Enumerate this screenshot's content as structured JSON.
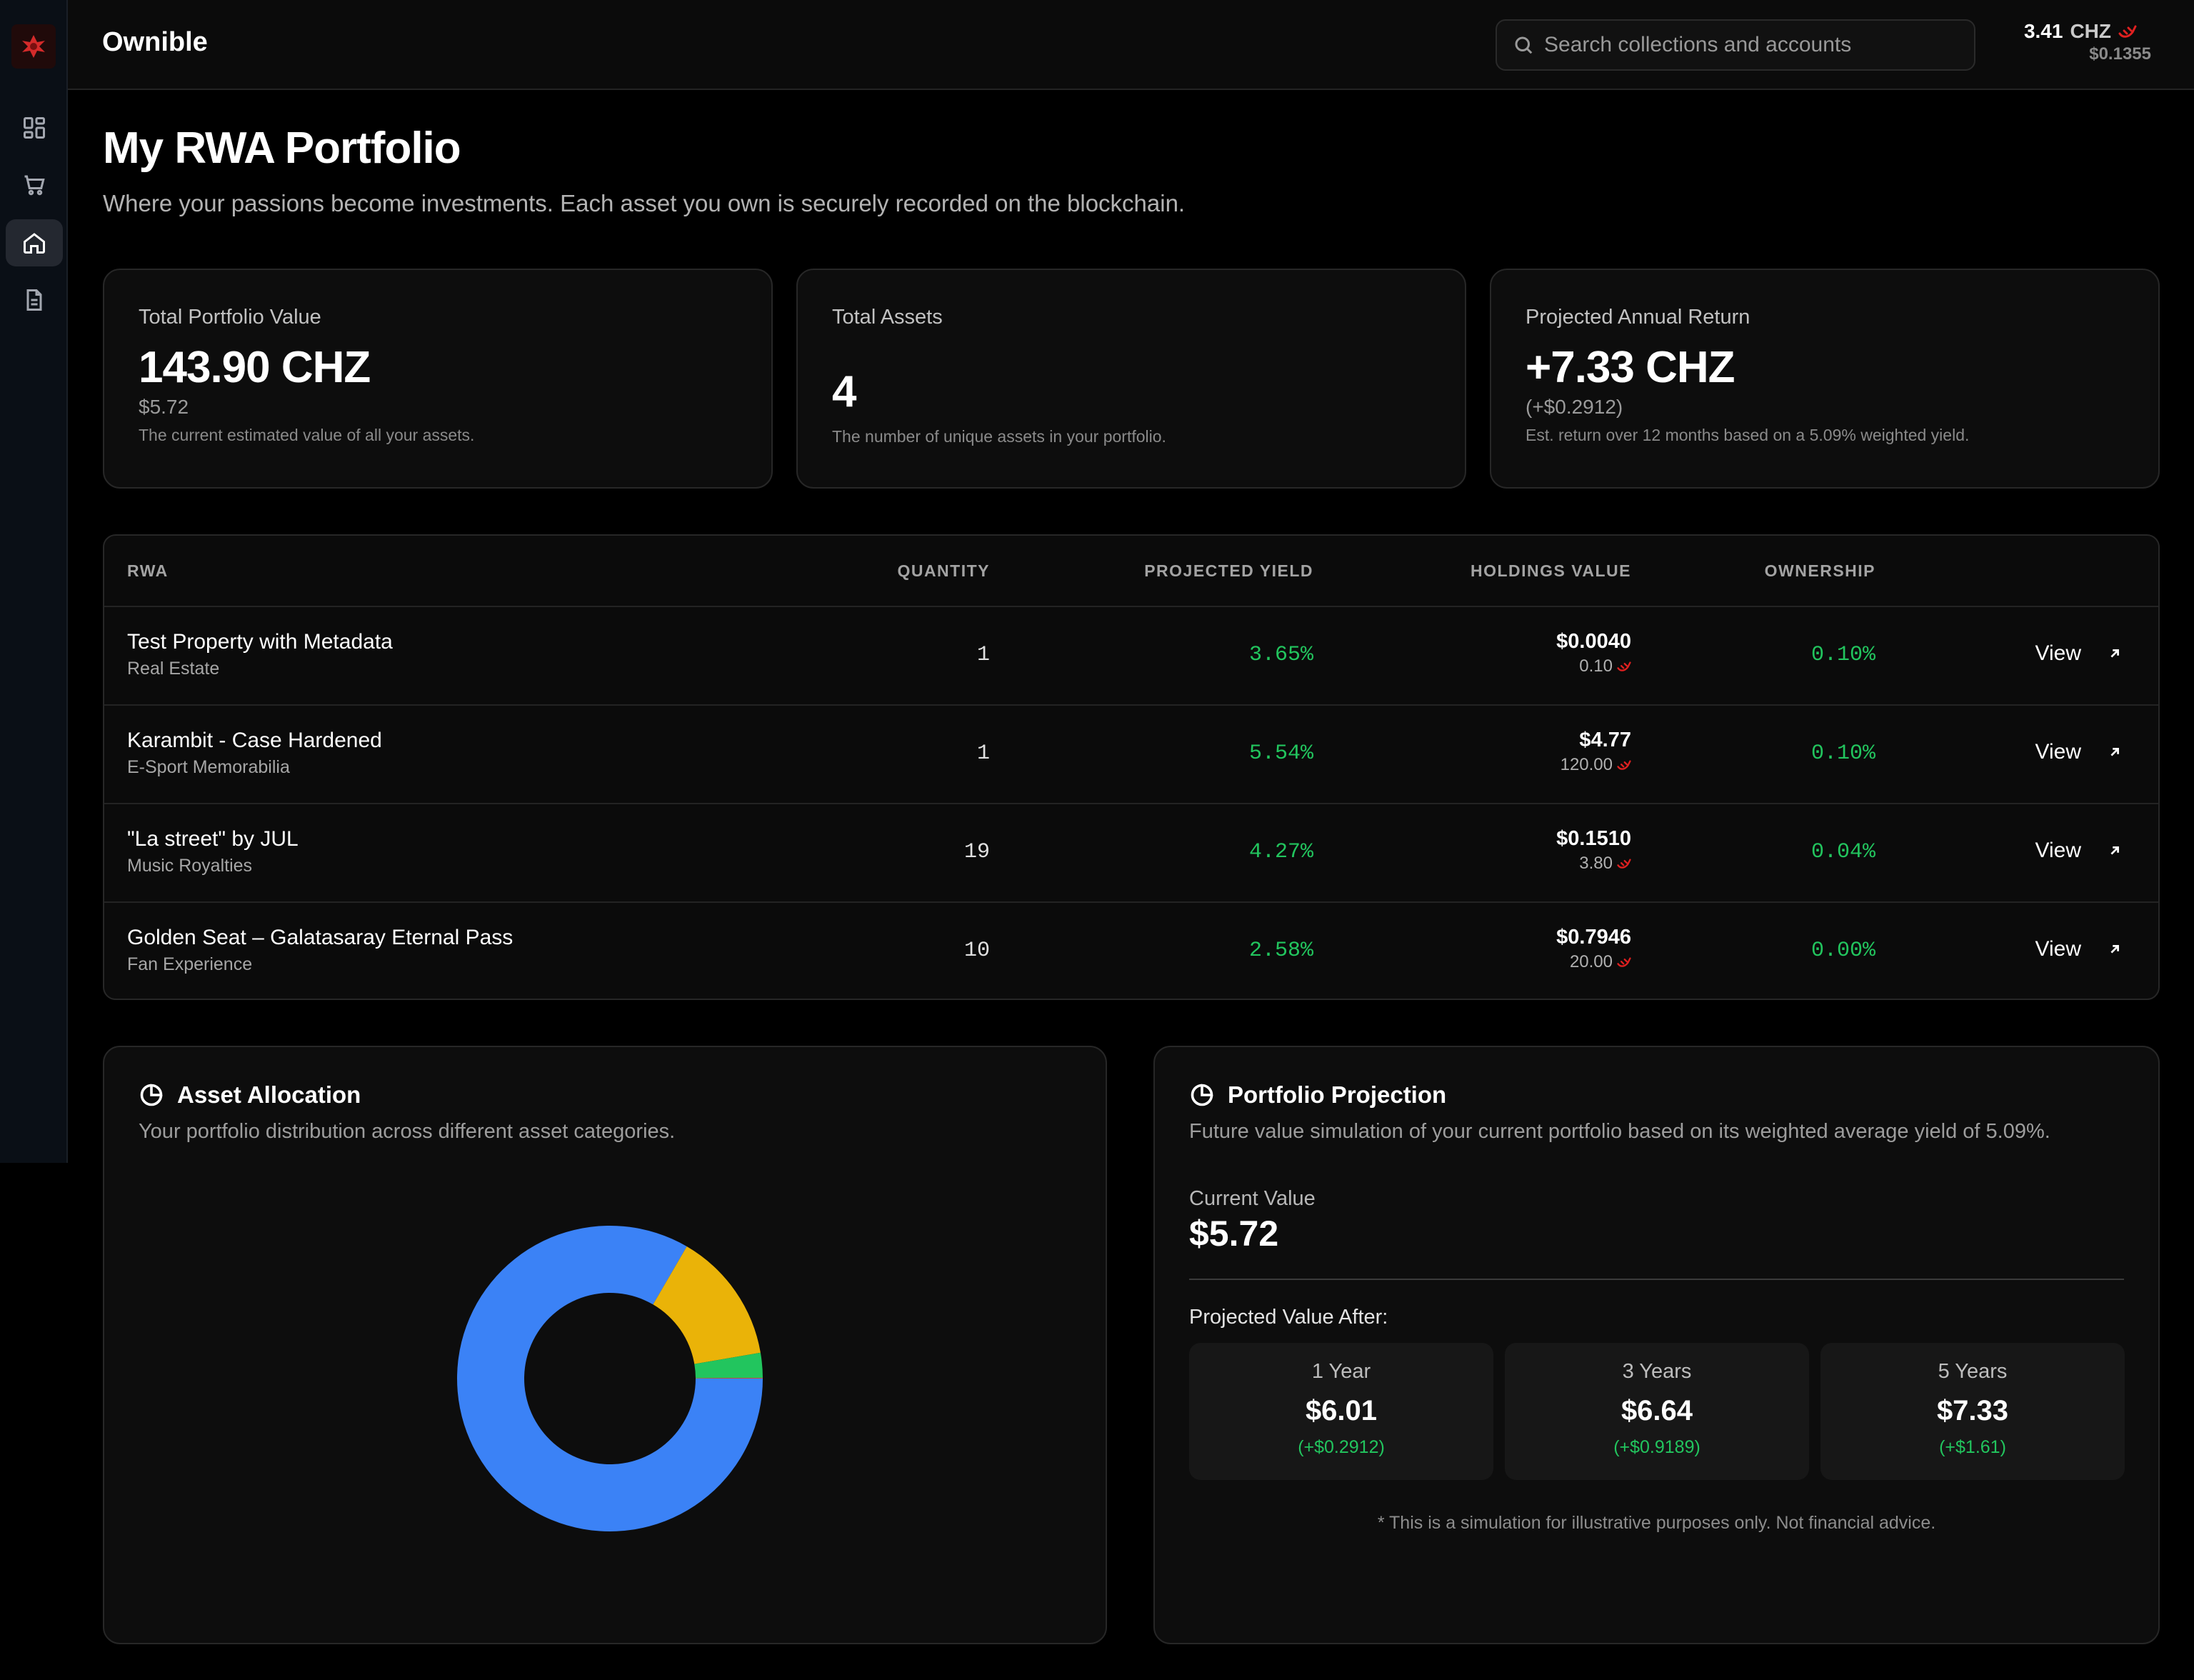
{
  "app": {
    "brand": "Ownible"
  },
  "search": {
    "placeholder": "Search collections and accounts"
  },
  "balance": {
    "amount": "3.41",
    "unit": "CHZ",
    "usd": "$0.1355"
  },
  "page": {
    "title": "My RWA Portfolio",
    "subtitle": "Where your passions become investments. Each asset you own is securely recorded on the blockchain."
  },
  "stats": [
    {
      "label": "Total Portfolio Value",
      "value": "143.90 CHZ",
      "secondary": "$5.72",
      "desc": "The current estimated value of all your assets."
    },
    {
      "label": "Total Assets",
      "value": "4",
      "secondary": "",
      "desc": "The number of unique assets in your portfolio."
    },
    {
      "label": "Projected Annual Return",
      "value": "+7.33 CHZ",
      "secondary": "(+$0.2912)",
      "desc": "Est. return over 12 months based on a 5.09% weighted yield."
    }
  ],
  "table": {
    "headers": {
      "rwa": "RWA",
      "quantity": "QUANTITY",
      "yield": "PROJECTED YIELD",
      "holdings": "HOLDINGS VALUE",
      "ownership": "OWNERSHIP"
    },
    "view_label": "View",
    "rows": [
      {
        "name": "Test Property with Metadata",
        "category": "Real Estate",
        "quantity": "1",
        "yield": "3.65%",
        "holdings_usd": "$0.0040",
        "holdings_chz": "0.10",
        "ownership": "0.10%"
      },
      {
        "name": "Karambit - Case Hardened",
        "category": "E-Sport Memorabilia",
        "quantity": "1",
        "yield": "5.54%",
        "holdings_usd": "$4.77",
        "holdings_chz": "120.00",
        "ownership": "0.10%"
      },
      {
        "name": "\"La street\" by JUL",
        "category": "Music Royalties",
        "quantity": "19",
        "yield": "4.27%",
        "holdings_usd": "$0.1510",
        "holdings_chz": "3.80",
        "ownership": "0.04%"
      },
      {
        "name": "Golden Seat – Galatasaray Eternal Pass",
        "category": "Fan Experience",
        "quantity": "10",
        "yield": "2.58%",
        "holdings_usd": "$0.7946",
        "holdings_chz": "20.00",
        "ownership": "0.00%"
      }
    ]
  },
  "allocation": {
    "title": "Asset Allocation",
    "subtitle": "Your portfolio distribution across different asset categories."
  },
  "projection": {
    "title": "Portfolio Projection",
    "subtitle": "Future value simulation of your current portfolio based on its weighted average yield of 5.09%.",
    "current_label": "Current Value",
    "current_value": "$5.72",
    "after_label": "Projected Value After:",
    "periods": [
      {
        "label": "1 Year",
        "value": "$6.01",
        "gain": "(+$0.2912)"
      },
      {
        "label": "3 Years",
        "value": "$6.64",
        "gain": "(+$0.9189)"
      },
      {
        "label": "5 Years",
        "value": "$7.33",
        "gain": "(+$1.61)"
      }
    ],
    "disclaimer": "* This is a simulation for illustrative purposes only. Not financial advice."
  },
  "chart_data": {
    "type": "pie",
    "categories": [
      "E-Sport Memorabilia",
      "Fan Experience",
      "Music Royalties",
      "Real Estate"
    ],
    "values": [
      120.0,
      20.0,
      3.8,
      0.1
    ],
    "colors": [
      "#3b82f6",
      "#eab308",
      "#22c55e",
      "#ef4444"
    ],
    "donut": true
  },
  "colors": {
    "accent_green": "#22c55e",
    "chz_red": "#e02020",
    "bg": "#000000"
  },
  "icons": {
    "nav": [
      "grid-icon",
      "cart-icon",
      "home-icon",
      "document-icon"
    ]
  }
}
